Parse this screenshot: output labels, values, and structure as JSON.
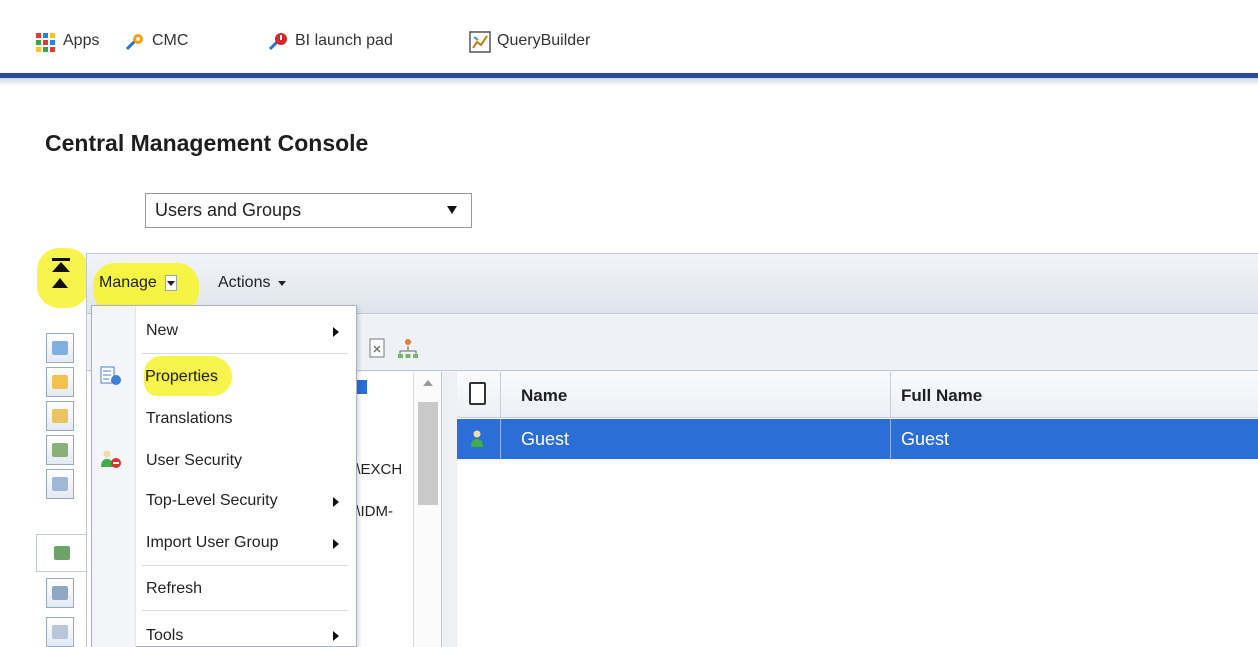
{
  "bookmarks": {
    "items": [
      {
        "label": "Apps",
        "icon": "apps-grid-icon"
      },
      {
        "label": "CMC",
        "icon": "cmc-star-icon"
      },
      {
        "label": "BI launch pad",
        "icon": "bi-launchpad-icon"
      },
      {
        "label": "QueryBuilder",
        "icon": "querybuilder-icon"
      }
    ]
  },
  "header": {
    "title": "Central Management Console"
  },
  "area_select": {
    "value": "Users and Groups"
  },
  "menubar": {
    "manage": "Manage",
    "actions": "Actions"
  },
  "manage_menu": {
    "items": [
      {
        "label": "New",
        "has_submenu": true
      },
      {
        "label": "Properties",
        "has_submenu": false,
        "highlighted": true
      },
      {
        "label": "Translations",
        "has_submenu": false
      },
      {
        "label": "User Security",
        "has_submenu": false
      },
      {
        "label": "Top-Level Security",
        "has_submenu": true
      },
      {
        "label": "Import User Group",
        "has_submenu": true
      },
      {
        "label": "Refresh",
        "has_submenu": false
      },
      {
        "label": "Tools",
        "has_submenu": true
      }
    ]
  },
  "tree": {
    "partial_items": [
      "n\\EXCH",
      "n\\IDM-"
    ]
  },
  "list": {
    "columns": [
      "Name",
      "Full Name"
    ],
    "rows": [
      {
        "name": "Guest",
        "full_name": "Guest",
        "selected": true
      }
    ]
  },
  "colors": {
    "accent_blue": "#274b94",
    "selection_blue": "#2b6ed7",
    "highlighter_yellow": "#f6f43a"
  }
}
